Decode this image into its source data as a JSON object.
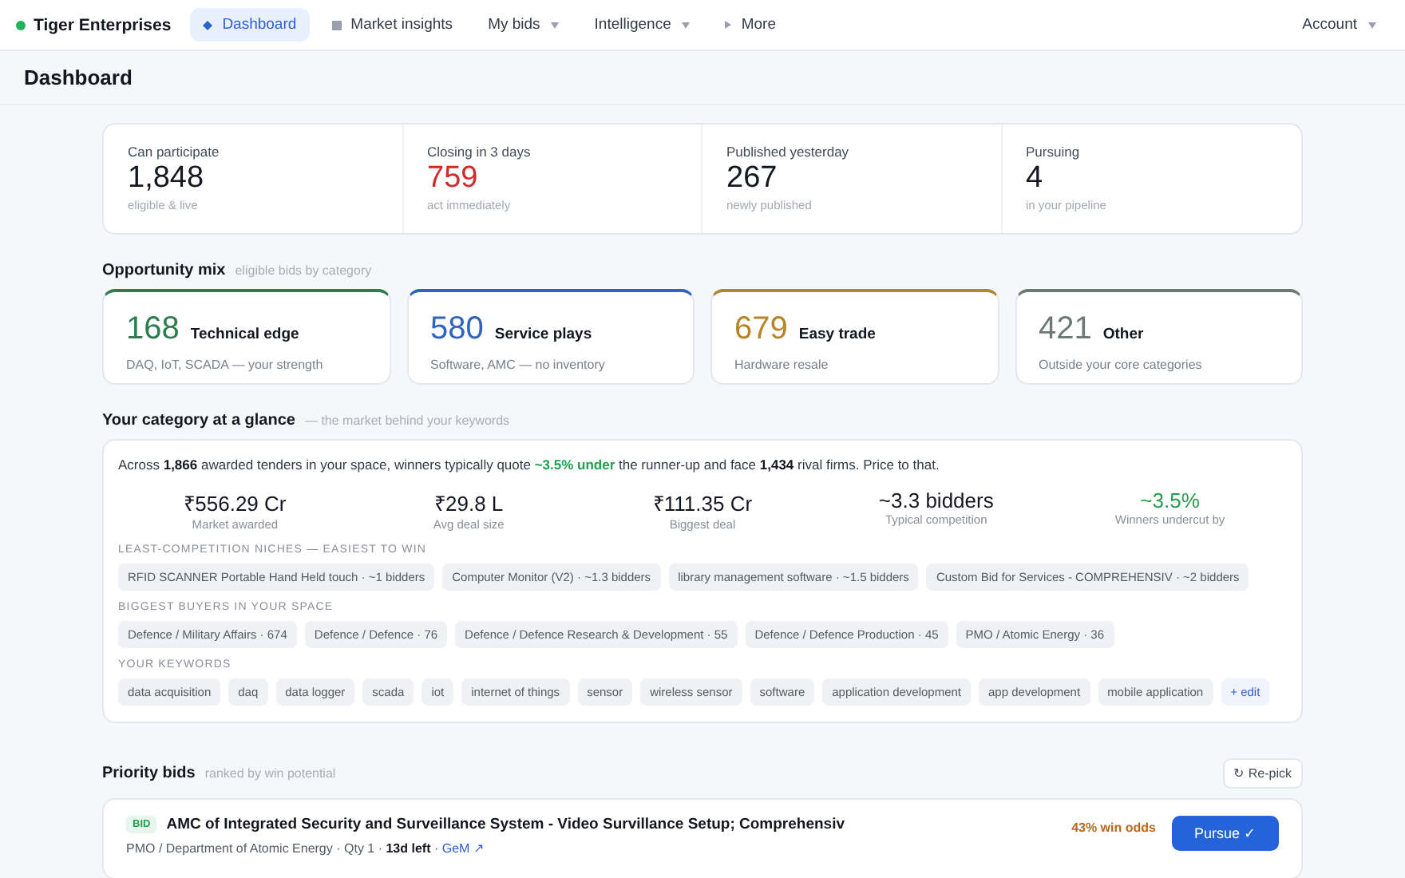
{
  "brand": {
    "name": "Tiger Enterprises"
  },
  "nav": [
    {
      "label": "Dashboard",
      "selected": true,
      "kind": "diamond",
      "dropdown": false
    },
    {
      "label": "Market insights",
      "selected": false,
      "kind": "square",
      "dropdown": false
    },
    {
      "label": "My bids",
      "selected": false,
      "kind": "plain",
      "dropdown": true
    },
    {
      "label": "Intelligence",
      "selected": false,
      "kind": "plain",
      "dropdown": true
    },
    {
      "label": "More",
      "selected": false,
      "kind": "triangle",
      "dropdown": false
    }
  ],
  "account": {
    "label": "Account",
    "dropdown": true
  },
  "page_title": "Dashboard",
  "stats": [
    {
      "label": "Can participate",
      "value": "1,848",
      "note": "eligible & live",
      "kind": "normal"
    },
    {
      "label": "Closing in 3 days",
      "value": "759",
      "note": "act immediately",
      "kind": "alert"
    },
    {
      "label": "Published yesterday",
      "value": "267",
      "note": "newly published",
      "kind": "normal"
    },
    {
      "label": "Pursuing",
      "value": "4",
      "note": "in your pipeline",
      "kind": "normal"
    }
  ],
  "mix": {
    "title": "Opportunity mix",
    "subtitle": "eligible bids by category",
    "cards": [
      {
        "value": "168",
        "name": "Technical edge",
        "note": "DAQ, IoT, SCADA — your strength",
        "color": "#2e7d4f"
      },
      {
        "value": "580",
        "name": "Service plays",
        "note": "Software, AMC — no inventory",
        "color": "#2f63c0"
      },
      {
        "value": "679",
        "name": "Easy trade",
        "note": "Hardware resale",
        "color": "#b7862a"
      },
      {
        "value": "421",
        "name": "Other",
        "note": "Outside your core categories",
        "color": "#6b7a72"
      }
    ]
  },
  "glance": {
    "title": "Your category at a glance",
    "subtitle": "— the market behind your keywords",
    "summary": [
      {
        "kind": "plain",
        "text": "Across "
      },
      {
        "kind": "bold",
        "text": "1,866"
      },
      {
        "kind": "plain",
        "text": " awarded tenders in your space, winners typically quote "
      },
      {
        "kind": "good",
        "text": "~3.5% under"
      },
      {
        "kind": "plain",
        "text": " the runner-up and face "
      },
      {
        "kind": "bold",
        "text": "1,434"
      },
      {
        "kind": "plain",
        "text": " rival firms. Price to that."
      }
    ],
    "metrics": [
      {
        "value": "₹556.29 Cr",
        "label": "Market awarded",
        "kind": "normal"
      },
      {
        "value": "₹29.8 L",
        "label": "Avg deal size",
        "kind": "normal"
      },
      {
        "value": "₹111.35 Cr",
        "label": "Biggest deal",
        "kind": "normal"
      },
      {
        "value": "~3.3 bidders",
        "label": "Typical competition",
        "kind": "normal"
      },
      {
        "value": "~3.5%",
        "label": "Winners undercut by",
        "kind": "good"
      }
    ],
    "groups": [
      {
        "title": "LEAST-COMPETITION NICHES — EASIEST TO WIN",
        "chips": [
          "RFID SCANNER Portable Hand Held touch · ~1 bidders",
          "Computer Monitor (V2) · ~1.3 bidders",
          "library management software · ~1.5 bidders",
          "Custom Bid for Services - COMPREHENSIV · ~2 bidders"
        ]
      },
      {
        "title": "BIGGEST BUYERS IN YOUR SPACE",
        "chips": [
          "Defence / Military Affairs · 674",
          "Defence / Defence · 76",
          "Defence / Defence Research & Development · 55",
          "Defence / Defence Production · 45",
          "PMO / Atomic Energy · 36"
        ]
      },
      {
        "title": "YOUR KEYWORDS",
        "chips": [
          "data acquisition",
          "daq",
          "data logger",
          "scada",
          "iot",
          "internet of things",
          "sensor",
          "wireless sensor",
          "software",
          "application development",
          "app development",
          "mobile application"
        ],
        "action": "+ edit"
      }
    ]
  },
  "priority": {
    "title": "Priority bids",
    "subtitle": "ranked by win potential",
    "repick": "↻ Re-pick",
    "bids": [
      {
        "tag": "BID",
        "title": "AMC of Integrated Security and Surveillance System - Video Survillance Setup; Comprehensiv",
        "odds": "43% win odds",
        "buyer": "PMO / Department of Atomic Energy · Qty 1 · ",
        "deadline": "13d left",
        "separator": " · ",
        "source": "GeM ↗",
        "action": "Pursue ✓"
      }
    ]
  }
}
